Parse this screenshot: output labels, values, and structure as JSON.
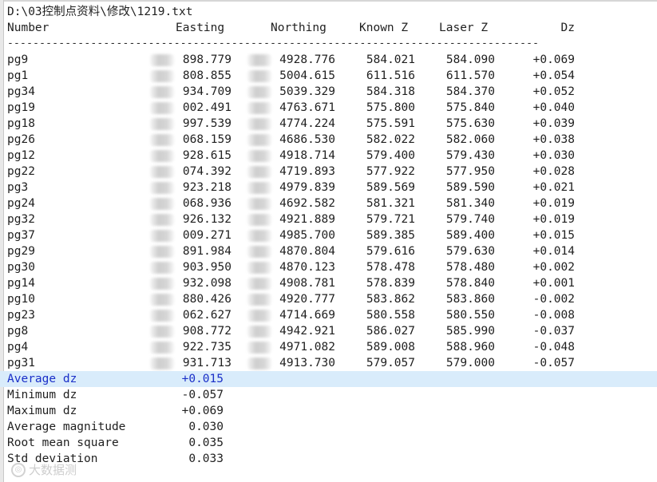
{
  "file": {
    "path": "D:\\03控制点资料\\修改\\1219.txt"
  },
  "table": {
    "headers": {
      "number": "Number",
      "easting": "Easting",
      "northing": "Northing",
      "known_z": "Known Z",
      "laser_z": "Laser Z",
      "dz": "Dz"
    },
    "separator": "-----------------------------------------------------------------------------------",
    "rows": [
      {
        "number": "pg9",
        "easting": "898.779",
        "northing": "4928.776",
        "known_z": "584.021",
        "laser_z": "584.090",
        "dz": "+0.069"
      },
      {
        "number": "pg1",
        "easting": "808.855",
        "northing": "5004.615",
        "known_z": "611.516",
        "laser_z": "611.570",
        "dz": "+0.054"
      },
      {
        "number": "pg34",
        "easting": "934.709",
        "northing": "5039.329",
        "known_z": "584.318",
        "laser_z": "584.370",
        "dz": "+0.052"
      },
      {
        "number": "pg19",
        "easting": "002.491",
        "northing": "4763.671",
        "known_z": "575.800",
        "laser_z": "575.840",
        "dz": "+0.040"
      },
      {
        "number": "pg18",
        "easting": "997.539",
        "northing": "4774.224",
        "known_z": "575.591",
        "laser_z": "575.630",
        "dz": "+0.039"
      },
      {
        "number": "pg26",
        "easting": "068.159",
        "northing": "4686.530",
        "known_z": "582.022",
        "laser_z": "582.060",
        "dz": "+0.038"
      },
      {
        "number": "pg12",
        "easting": "928.615",
        "northing": "4918.714",
        "known_z": "579.400",
        "laser_z": "579.430",
        "dz": "+0.030"
      },
      {
        "number": "pg22",
        "easting": "074.392",
        "northing": "4719.893",
        "known_z": "577.922",
        "laser_z": "577.950",
        "dz": "+0.028"
      },
      {
        "number": "pg3",
        "easting": "923.218",
        "northing": "4979.839",
        "known_z": "589.569",
        "laser_z": "589.590",
        "dz": "+0.021"
      },
      {
        "number": "pg24",
        "easting": "068.936",
        "northing": "4692.582",
        "known_z": "581.321",
        "laser_z": "581.340",
        "dz": "+0.019"
      },
      {
        "number": "pg32",
        "easting": "926.132",
        "northing": "4921.889",
        "known_z": "579.721",
        "laser_z": "579.740",
        "dz": "+0.019"
      },
      {
        "number": "pg37",
        "easting": "009.271",
        "northing": "4985.700",
        "known_z": "589.385",
        "laser_z": "589.400",
        "dz": "+0.015"
      },
      {
        "number": "pg29",
        "easting": "891.984",
        "northing": "4870.804",
        "known_z": "579.616",
        "laser_z": "579.630",
        "dz": "+0.014"
      },
      {
        "number": "pg30",
        "easting": "903.950",
        "northing": "4870.123",
        "known_z": "578.478",
        "laser_z": "578.480",
        "dz": "+0.002"
      },
      {
        "number": "pg14",
        "easting": "932.098",
        "northing": "4908.781",
        "known_z": "578.839",
        "laser_z": "578.840",
        "dz": "+0.001"
      },
      {
        "number": "pg10",
        "easting": "880.426",
        "northing": "4920.777",
        "known_z": "583.862",
        "laser_z": "583.860",
        "dz": "-0.002"
      },
      {
        "number": "pg23",
        "easting": "062.627",
        "northing": "4714.669",
        "known_z": "580.558",
        "laser_z": "580.550",
        "dz": "-0.008"
      },
      {
        "number": "pg8",
        "easting": "908.772",
        "northing": "4942.921",
        "known_z": "586.027",
        "laser_z": "585.990",
        "dz": "-0.037"
      },
      {
        "number": "pg4",
        "easting": "922.735",
        "northing": "4971.082",
        "known_z": "589.008",
        "laser_z": "588.960",
        "dz": "-0.048"
      },
      {
        "number": "pg31",
        "easting": "931.713",
        "northing": "4913.730",
        "known_z": "579.057",
        "laser_z": "579.000",
        "dz": "-0.057"
      }
    ]
  },
  "stats": [
    {
      "label": "Average dz",
      "value": "+0.015"
    },
    {
      "label": "Minimum dz",
      "value": "-0.057"
    },
    {
      "label": "Maximum dz",
      "value": "+0.069"
    },
    {
      "label": "Average magnitude",
      "value": "0.030"
    },
    {
      "label": "Root mean square",
      "value": "0.035"
    },
    {
      "label": "Std deviation",
      "value": "0.033"
    }
  ],
  "watermark": {
    "text": "大数据测"
  },
  "colors": {
    "highlight_bg": "#d9ecfb",
    "highlight_text": "#1a2fc8"
  }
}
